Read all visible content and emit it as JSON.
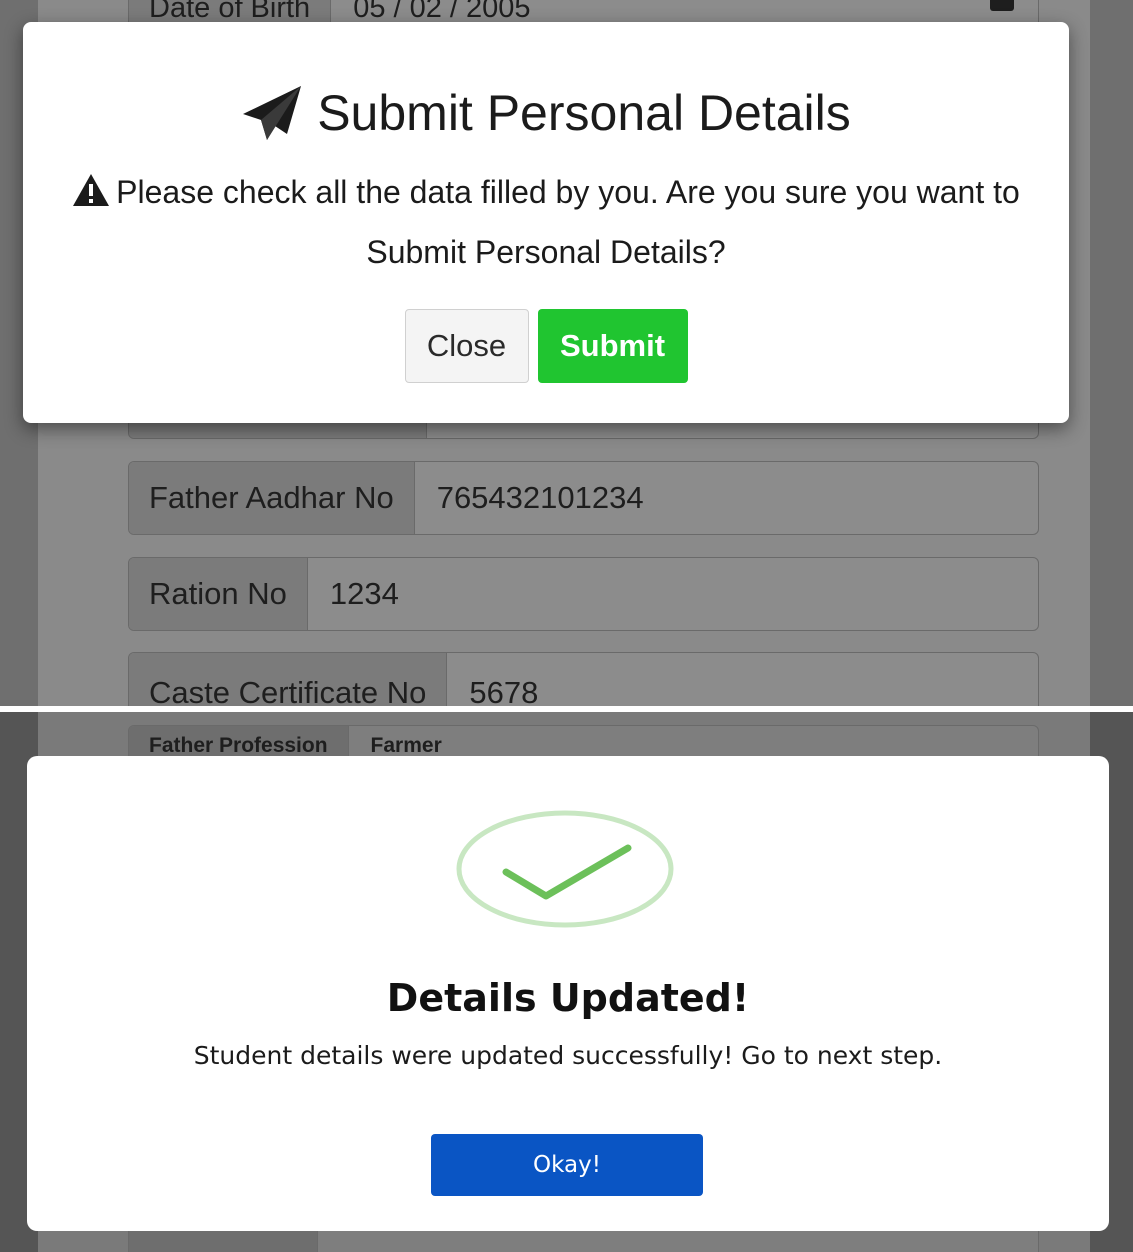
{
  "top_screen": {
    "form": {
      "dob": {
        "label": "Date of Birth",
        "value": "05 / 02 / 2005"
      },
      "father_aadhar": {
        "label": "Father Aadhar No",
        "value": "765432101234"
      },
      "ration": {
        "label": "Ration No",
        "value": "1234"
      },
      "caste": {
        "label": "Caste Certificate No",
        "value": "5678"
      }
    },
    "modal": {
      "title": "Submit Personal Details",
      "message": "Please check all the data filled by you. Are you sure you want to Submit Personal Details?",
      "close_label": "Close",
      "submit_label": "Submit",
      "title_icon": "paper-plane-icon",
      "warning_icon": "warning-icon",
      "submit_color": "#20c530"
    }
  },
  "bottom_screen": {
    "form": {
      "father_profession": {
        "label": "Father Profession",
        "value": "Farmer"
      }
    },
    "modal": {
      "title": "Details Updated!",
      "message": "Student details were updated successfully! Go to next step.",
      "okay_label": "Okay!",
      "icon": "success-check-icon",
      "okay_color": "#0a55c4"
    }
  }
}
